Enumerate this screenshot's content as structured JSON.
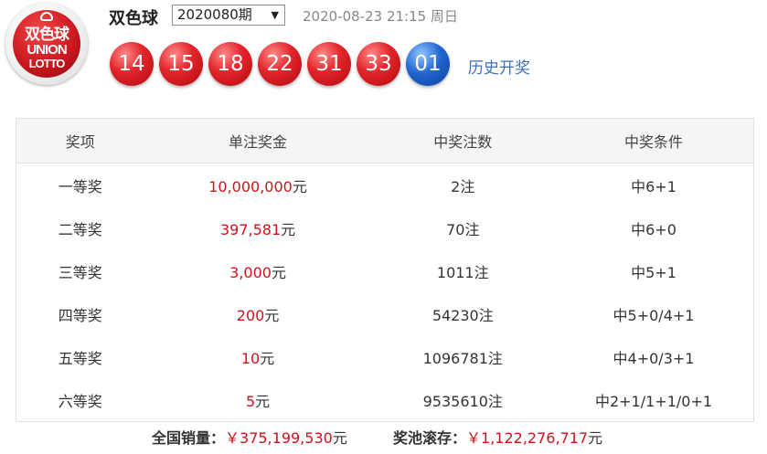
{
  "header": {
    "game_name": "双色球",
    "issue": "2020080期",
    "draw_time": "2020-08-23 21:15 周日",
    "history_link": "历史开奖",
    "logo": {
      "cn": "双色球",
      "en1": "UNION",
      "en2": "LOTTO"
    }
  },
  "balls": {
    "red": [
      "14",
      "15",
      "18",
      "22",
      "31",
      "33"
    ],
    "blue": "01"
  },
  "table": {
    "headers": [
      "奖项",
      "单注奖金",
      "中奖注数",
      "中奖条件"
    ],
    "rows": [
      {
        "level": "一等奖",
        "amount": "10,000,000",
        "unit": "元",
        "count": "2注",
        "condition": "中6+1"
      },
      {
        "level": "二等奖",
        "amount": "397,581",
        "unit": "元",
        "count": "70注",
        "condition": "中6+0"
      },
      {
        "level": "三等奖",
        "amount": "3,000",
        "unit": "元",
        "count": "1011注",
        "condition": "中5+1"
      },
      {
        "level": "四等奖",
        "amount": "200",
        "unit": "元",
        "count": "54230注",
        "condition": "中5+0/4+1"
      },
      {
        "level": "五等奖",
        "amount": "10",
        "unit": "元",
        "count": "1096781注",
        "condition": "中4+0/3+1"
      },
      {
        "level": "六等奖",
        "amount": "5",
        "unit": "元",
        "count": "9535610注",
        "condition": "中2+1/1+1/0+1"
      }
    ]
  },
  "footer": {
    "sales_label": "全国销量：",
    "sales_value": "￥375,199,530",
    "sales_unit": "元",
    "pool_label": "奖池滚存：",
    "pool_value": "￥1,122,276,717",
    "pool_unit": "元"
  },
  "colors": {
    "red_ball": "#e2262c",
    "blue_ball": "#2266d2",
    "amount_red": "#d0121b",
    "link": "#3f6fbd"
  }
}
